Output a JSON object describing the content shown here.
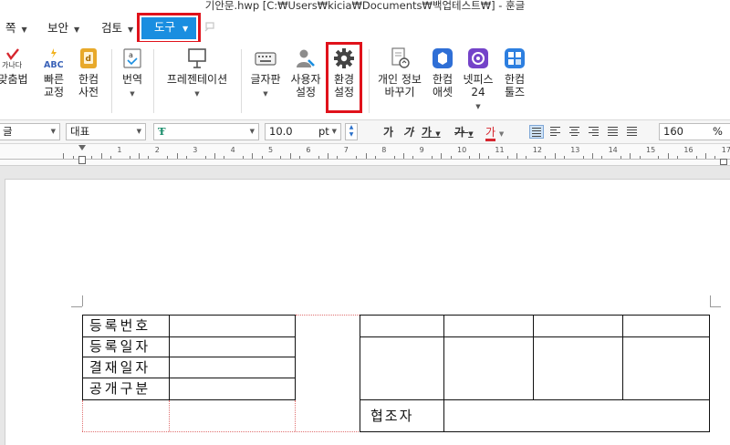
{
  "window": {
    "title": "기안문.hwp [C:₩Users₩kicia₩Documents₩백업테스트₩] - 훈글"
  },
  "menu": {
    "items": [
      {
        "label": "쪽"
      },
      {
        "label": "보안"
      },
      {
        "label": "검토"
      },
      {
        "label": "도구"
      }
    ]
  },
  "ribbon": {
    "spell": {
      "label": "맞춤법",
      "icon_text": "가나다"
    },
    "quick_fix": {
      "label1": "빠른",
      "label2": "교정",
      "icon_text": "ABC"
    },
    "dictionary": {
      "label1": "한컴",
      "label2": "사전"
    },
    "translate": {
      "label": "번역"
    },
    "presentation": {
      "label": "프레젠테이션"
    },
    "keyboard": {
      "label": "글자판"
    },
    "user_settings": {
      "label1": "사용자",
      "label2": "설정"
    },
    "preferences": {
      "label1": "환경",
      "label2": "설정"
    },
    "privacy": {
      "label1": "개인 정보",
      "label2": "바꾸기"
    },
    "hancom_asset": {
      "label1": "한컴",
      "label2": "애셋"
    },
    "netffice": {
      "label1": "넷피스",
      "label2": "24"
    },
    "hancom_tools": {
      "label1": "한컴",
      "label2": "툴즈"
    }
  },
  "format": {
    "language": "글",
    "style": "대표",
    "font": "",
    "size": "10.0",
    "size_unit": "pt",
    "zoom": "160",
    "zoom_unit": "%"
  },
  "ruler": {
    "numbers": [
      "1",
      "2",
      "3",
      "4",
      "5",
      "6",
      "7",
      "8",
      "9",
      "10",
      "11",
      "12",
      "13",
      "14",
      "15",
      "16",
      "17"
    ]
  },
  "document": {
    "left_table": [
      "등록번호",
      "등록일자",
      "결재일자",
      "공개구분"
    ],
    "right_table": {
      "cooperator": "협조자"
    }
  }
}
